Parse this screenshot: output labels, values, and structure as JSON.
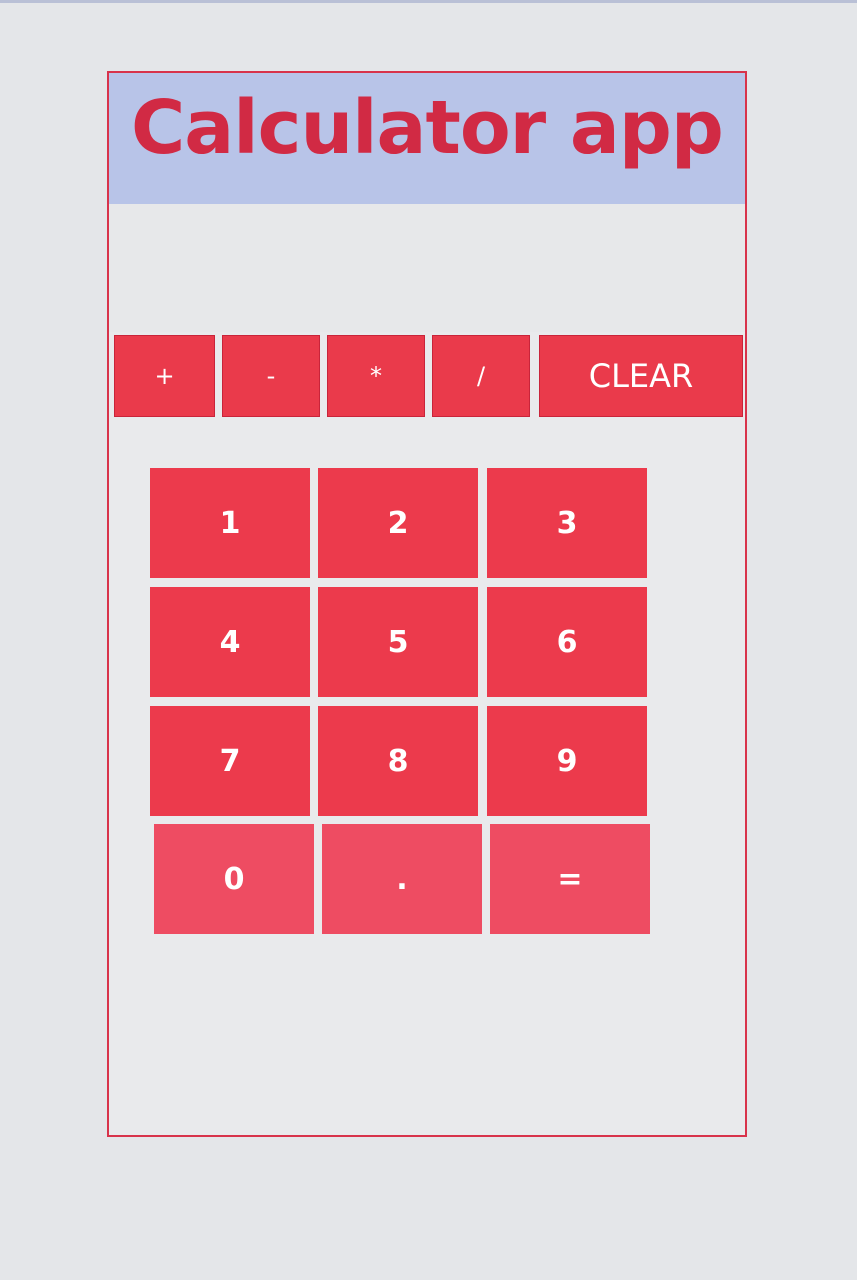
{
  "app": {
    "title": "Calculator app"
  },
  "display": {
    "value": ""
  },
  "operators": [
    {
      "label": "+"
    },
    {
      "label": "-"
    },
    {
      "label": "*"
    },
    {
      "label": "/"
    },
    {
      "label": "CLEAR"
    }
  ],
  "keypad": [
    {
      "label": "1"
    },
    {
      "label": "2"
    },
    {
      "label": "3"
    },
    {
      "label": "4"
    },
    {
      "label": "5"
    },
    {
      "label": "6"
    },
    {
      "label": "7"
    },
    {
      "label": "8"
    },
    {
      "label": "9"
    },
    {
      "label": "0"
    },
    {
      "label": "."
    },
    {
      "label": "="
    }
  ],
  "colors": {
    "accent": "#e8394b",
    "title_text": "#d12a44",
    "title_background": "#b8c4e8",
    "frame_border": "#d8334b",
    "button_text": "#ffffff"
  }
}
